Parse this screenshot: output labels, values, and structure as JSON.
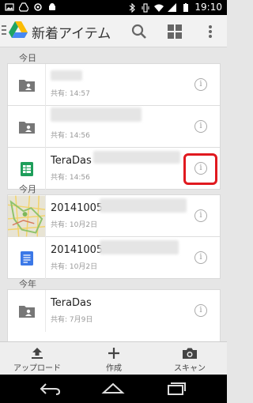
{
  "status_bar": {
    "time": "19:10"
  },
  "app": {
    "title": "新着アイテム"
  },
  "sections": [
    {
      "header": "今日",
      "items": [
        {
          "name": "",
          "shared": "共有: 14:57"
        },
        {
          "name": "",
          "shared": "共有: 14:56"
        },
        {
          "name": "TeraDas",
          "shared": "共有: 14:56"
        }
      ]
    },
    {
      "header": "今月",
      "items": [
        {
          "name": "20141005",
          "shared": "共有: 10月2日"
        },
        {
          "name": "20141005",
          "shared": "共有: 10月2日"
        }
      ]
    },
    {
      "header": "今年",
      "items": [
        {
          "name": "TeraDas",
          "shared": "共有: 7月9日"
        }
      ]
    }
  ],
  "toolbar": {
    "upload_label": "アップロード",
    "create_label": "作成",
    "scan_label": "スキャン"
  },
  "icons": {
    "info": "i"
  },
  "colors": {
    "highlight": "#e0191f",
    "sheets_green": "#1e9e5a",
    "docs_blue": "#3b78e7"
  }
}
